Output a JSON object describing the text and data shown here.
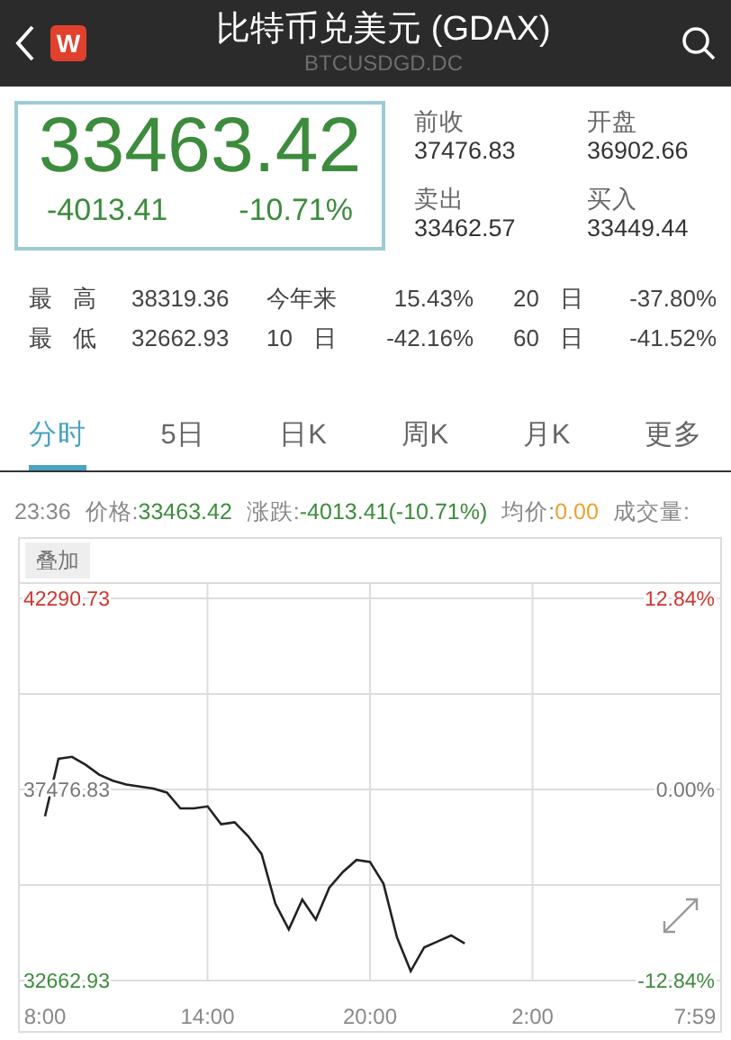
{
  "header": {
    "logo_text": "W",
    "title": "比特币兑美元 (GDAX)",
    "subtitle": "BTCUSDGD.DC"
  },
  "quote": {
    "price": "33463.42",
    "change": "-4013.41",
    "change_pct": "-10.71%"
  },
  "quote_fields": [
    {
      "label": "前收",
      "value": "37476.83"
    },
    {
      "label": "开盘",
      "value": "36902.66"
    },
    {
      "label": "卖出",
      "value": "33462.57"
    },
    {
      "label": "买入",
      "value": "33449.44"
    }
  ],
  "stats": [
    [
      {
        "label": "最 高",
        "value": "38319.36"
      },
      {
        "label": "今年来",
        "value": "15.43%"
      },
      {
        "label": "20 日",
        "value": "-37.80%"
      }
    ],
    [
      {
        "label": "最 低",
        "value": "32662.93"
      },
      {
        "label": "10 日",
        "value": "-42.16%"
      },
      {
        "label": "60 日",
        "value": "-41.52%"
      }
    ]
  ],
  "tabs": [
    {
      "label": "分时",
      "selected": true
    },
    {
      "label": "5日",
      "selected": false
    },
    {
      "label": "日K",
      "selected": false
    },
    {
      "label": "周K",
      "selected": false
    },
    {
      "label": "月K",
      "selected": false
    },
    {
      "label": "更多",
      "selected": false
    }
  ],
  "info_bar": [
    {
      "label": "23:36"
    },
    {
      "label": "价格:",
      "value": "33463.42",
      "color": "#3d8b3d"
    },
    {
      "label": "涨跌:",
      "value": "-4013.41(-10.71%)",
      "color": "#3d8b3d"
    },
    {
      "label": "均价:",
      "value": "0.00",
      "color": "#f0a030"
    },
    {
      "label": "成交量:"
    }
  ],
  "chart": {
    "overlay_button": "叠加",
    "percent_labels": [
      "12.84%",
      "0.00%",
      "-12.84%"
    ],
    "chart_data": {
      "type": "line",
      "grid": true,
      "ylim": [
        32662.93,
        42290.73
      ],
      "yticks": [
        {
          "value": 42290.73,
          "label": "42290.73"
        },
        {
          "value": 37476.83,
          "label": "37476.83"
        },
        {
          "value": 32662.93,
          "label": "32662.93"
        }
      ],
      "categories": [
        "8:00",
        null,
        null,
        null,
        null,
        null,
        null,
        null,
        null,
        null,
        null,
        null,
        "14:00",
        null,
        null,
        null,
        null,
        null,
        null,
        null,
        null,
        null,
        null,
        null,
        "20:00",
        null,
        null,
        null,
        null,
        null,
        null,
        null,
        null,
        null,
        null,
        null,
        "2:00",
        null,
        null,
        null,
        null,
        null,
        null,
        null,
        null,
        null,
        null,
        null,
        "7:59"
      ],
      "series": [
        {
          "color": "#222222",
          "values": [
            36800,
            38250,
            38300,
            38100,
            37850,
            37700,
            37600,
            37550,
            37500,
            37400,
            37000,
            37000,
            37050,
            36600,
            36650,
            36300,
            35850,
            34600,
            33950,
            34700,
            34200,
            35000,
            35400,
            35700,
            35650,
            35100,
            33750,
            32900,
            33500,
            33650,
            33800,
            33600,
            null,
            null,
            null,
            null,
            null,
            null,
            null,
            null,
            null,
            null,
            null,
            null,
            null,
            null,
            null,
            null,
            null
          ]
        }
      ]
    }
  }
}
